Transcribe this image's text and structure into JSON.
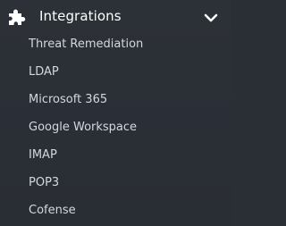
{
  "menu": {
    "section_title": "Integrations",
    "section_icon": "puzzle-piece-icon",
    "toggle_icon": "chevron-down-icon",
    "colors": {
      "background": "#2a2e35",
      "title": "#ffffff",
      "item_text": "#d4d8dd"
    },
    "items": [
      {
        "label": "Threat Remediation"
      },
      {
        "label": "LDAP"
      },
      {
        "label": "Microsoft 365"
      },
      {
        "label": "Google Workspace"
      },
      {
        "label": "IMAP"
      },
      {
        "label": "POP3"
      },
      {
        "label": "Cofense"
      }
    ]
  }
}
